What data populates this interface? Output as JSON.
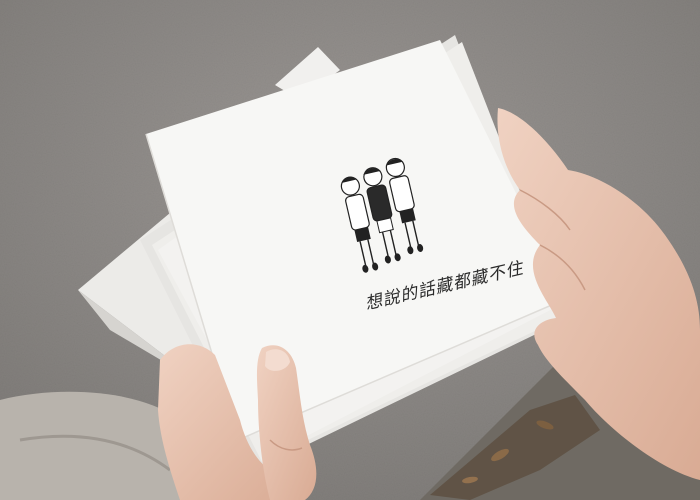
{
  "photo": {
    "card_caption": "想說的話藏都藏不住",
    "colors": {
      "ground": "#8d8a87",
      "card": "#f7f7f5",
      "skin": "#e9c4b1",
      "ink": "#2b2b2b"
    }
  }
}
